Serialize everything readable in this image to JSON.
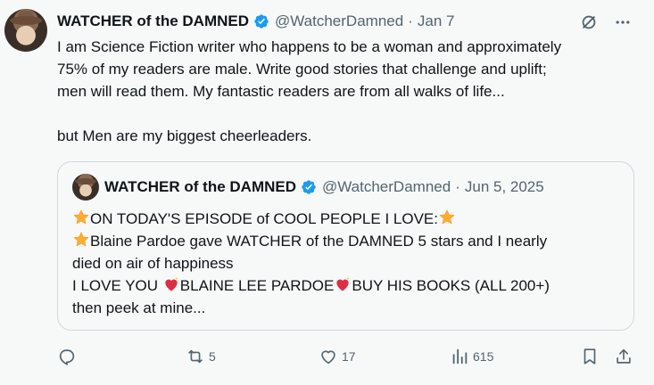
{
  "post": {
    "author_name": "WATCHER of the DAMNED",
    "handle": "@WatcherDamned",
    "separator": "·",
    "date": "Jan 7",
    "text_lines": [
      "I am Science Fiction writer who happens to be a woman and approximately",
      "75% of my readers are male. Write good stories that challenge and uplift;",
      "men will read them. My fantastic readers are from all walks of life..."
    ],
    "text_line_2": "but Men are my biggest cheerleaders."
  },
  "quote": {
    "author_name": "WATCHER of the DAMNED",
    "handle": "@WatcherDamned",
    "separator": "·",
    "date": "Jun 5, 2025",
    "line1": "ON TODAY'S EPISODE of COOL PEOPLE I LOVE:",
    "line2a": "Blaine Pardoe gave WATCHER of the DAMNED 5 stars and I nearly",
    "line2b": "died on air of happiness",
    "line3a": "I LOVE YOU ",
    "line3b": "BLAINE LEE PARDOE",
    "line3c": "BUY  HIS  BOOKS  (ALL  200+)",
    "line4": "then  peek  at  mine..."
  },
  "actions": {
    "reply_count": "",
    "repost_count": "5",
    "like_count": "17",
    "views_count": "615"
  },
  "icons": {
    "verified": "verified-badge-icon",
    "grok": "grok-icon",
    "more": "more-icon",
    "reply": "reply-icon",
    "repost": "repost-icon",
    "like": "like-icon",
    "views": "views-icon",
    "bookmark": "bookmark-icon",
    "share": "share-icon"
  },
  "colors": {
    "verified": "#1d9bf0",
    "text": "#0f1419",
    "muted": "#536471",
    "border": "#cfd9de",
    "background": "#f7f9f9"
  }
}
